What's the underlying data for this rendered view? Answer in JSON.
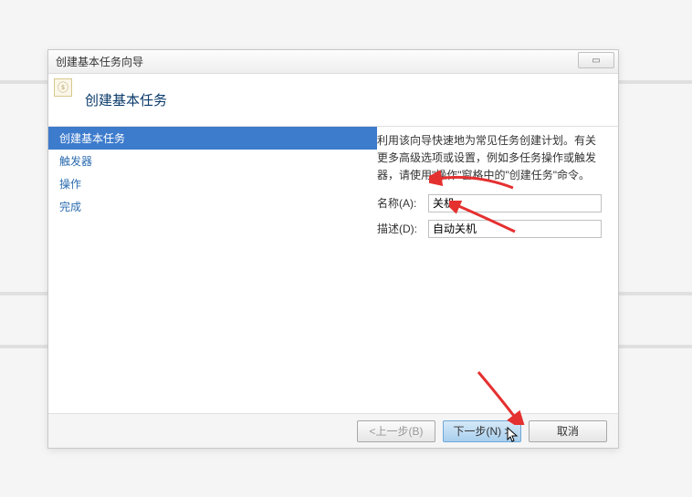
{
  "dialog": {
    "title": "创建基本任务向导",
    "close_glyph": "▭"
  },
  "header": {
    "title": "创建基本任务",
    "icon_glyph": "ⓢ"
  },
  "sidebar": {
    "items": [
      {
        "label": "创建基本任务",
        "active": true
      },
      {
        "label": "触发器",
        "active": false
      },
      {
        "label": "操作",
        "active": false
      },
      {
        "label": "完成",
        "active": false
      }
    ]
  },
  "form": {
    "intro": "利用该向导快速地为常见任务创建计划。有关更多高级选项或设置，例如多任务操作或触发器，请使用\"操作\"窗格中的\"创建任务\"命令。",
    "name_label": "名称(A):",
    "name_value": "关机",
    "desc_label": "描述(D):",
    "desc_value": "自动关机"
  },
  "buttons": {
    "back": "<上一步(B)",
    "next": "下一步(N) >",
    "cancel": "取消"
  }
}
